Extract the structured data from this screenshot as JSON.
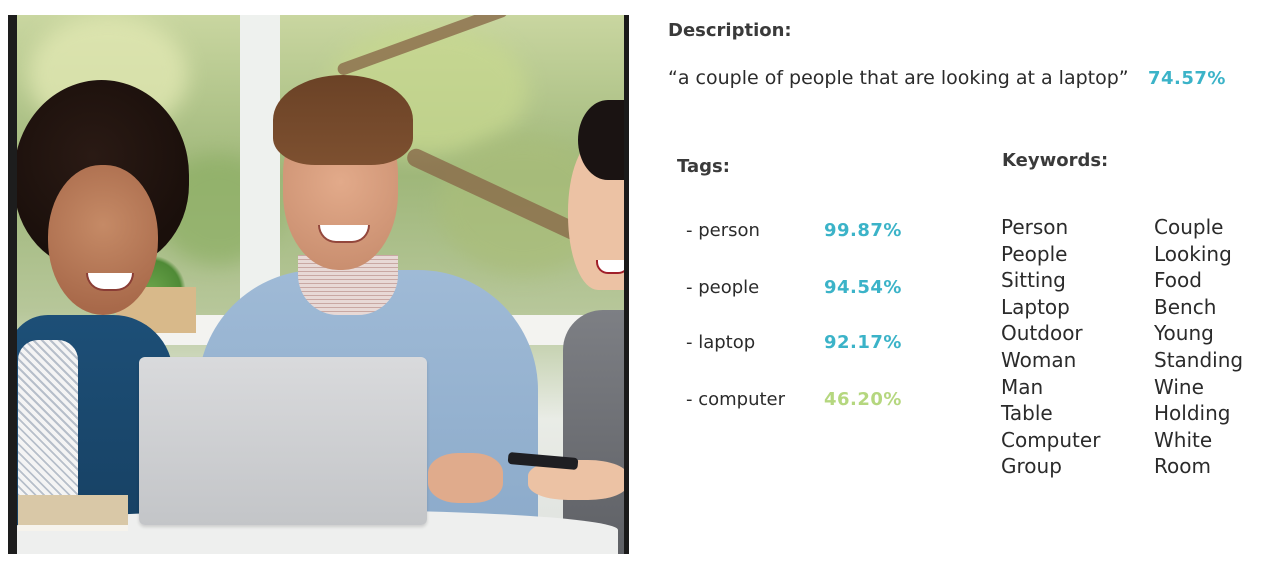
{
  "image": {
    "alt": "Three smiling people looking at a laptop at a table by a window"
  },
  "description": {
    "label": "Description:",
    "text": "“a couple of people that are looking at a laptop”",
    "confidence": "74.57%",
    "confidence_color": "#3bb3c8"
  },
  "tags": {
    "label": "Tags:",
    "items": [
      {
        "name": "- person",
        "confidence": "99.87%",
        "color": "#3bb3c8"
      },
      {
        "name": "- people",
        "confidence": "94.54%",
        "color": "#3bb3c8"
      },
      {
        "name": "- laptop",
        "confidence": "92.17%",
        "color": "#3bb3c8"
      },
      {
        "name": "- computer",
        "confidence": "46.20%",
        "color": "#b5d77f"
      }
    ]
  },
  "keywords": {
    "label": "Keywords:",
    "column1": [
      "Person",
      "People",
      "Sitting",
      "Laptop",
      "Outdoor",
      "Woman",
      "Man",
      "Table",
      "Computer",
      "Group"
    ],
    "column2": [
      "Couple",
      "Looking",
      "Food",
      "Bench",
      "Young",
      "Standing",
      "Wine",
      "Holding",
      "White",
      "Room"
    ]
  }
}
